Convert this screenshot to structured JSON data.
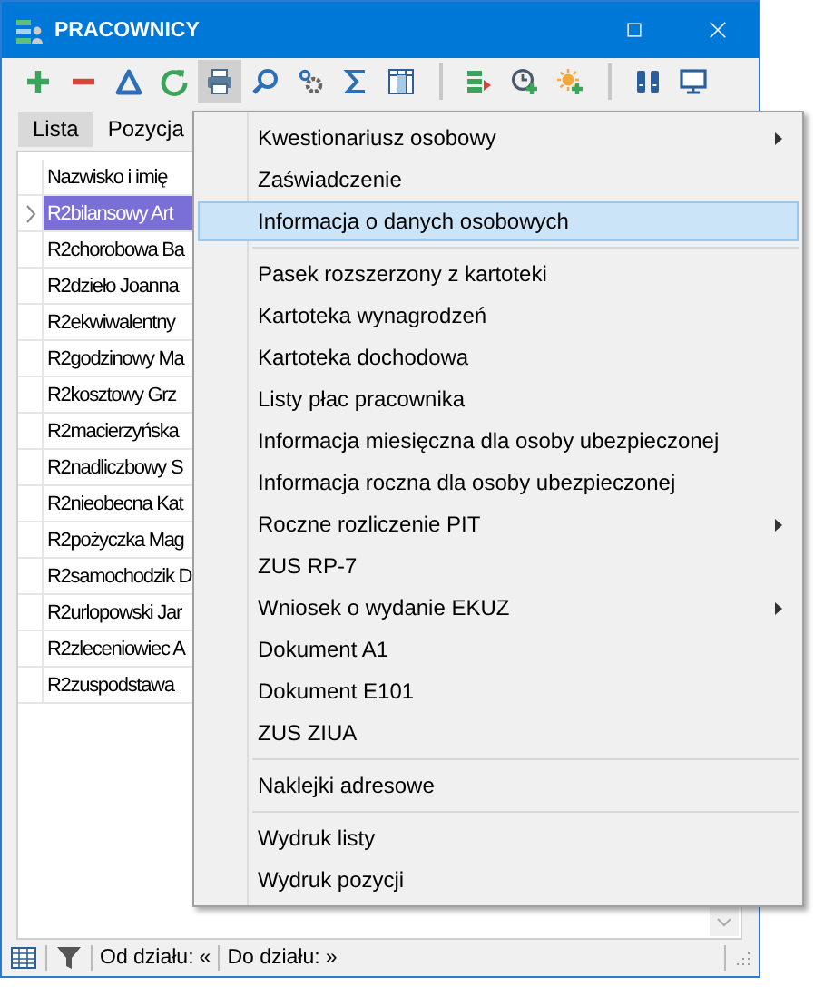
{
  "window": {
    "title": "PRACOWNICY"
  },
  "toolbar": {
    "groups": [
      [
        {
          "pressed": false
        },
        {
          "pressed": false
        },
        {
          "pressed": false
        },
        {
          "pressed": false
        },
        {
          "pressed": true
        },
        {
          "pressed": false
        },
        {
          "pressed": false
        },
        {
          "pressed": false
        },
        {
          "pressed": false
        }
      ],
      [
        {
          "pressed": false
        },
        {
          "pressed": false
        },
        {
          "pressed": false
        }
      ],
      [
        {
          "pressed": false
        },
        {
          "pressed": false
        }
      ]
    ]
  },
  "tabs": [
    {
      "label": "Lista",
      "selected": true
    },
    {
      "label": "Pozycja",
      "selected": false
    }
  ],
  "table": {
    "columns": [
      "Nazwisko i imię"
    ],
    "rows": [
      {
        "name": "R2bilansowy Art",
        "selected": true
      },
      {
        "name": "R2chorobowa Ba",
        "selected": false
      },
      {
        "name": "R2dzieło Joanna",
        "selected": false
      },
      {
        "name": "R2ekwiwalentny",
        "selected": false
      },
      {
        "name": "R2godzinowy Ma",
        "selected": false
      },
      {
        "name": "R2kosztowy Grz",
        "selected": false
      },
      {
        "name": "R2macierzyńska",
        "selected": false
      },
      {
        "name": "R2nadliczbowy S",
        "selected": false
      },
      {
        "name": "R2nieobecna Kat",
        "selected": false
      },
      {
        "name": "R2pożyczka Mag",
        "selected": false
      },
      {
        "name": "R2samochodzik D",
        "selected": false
      },
      {
        "name": "R2urlopowski Jar",
        "selected": false
      },
      {
        "name": "R2zleceniowiec A",
        "selected": false
      },
      {
        "name": "R2zuspodstawa",
        "selected": false
      }
    ]
  },
  "status_bar": {
    "from_label": "Od działu:",
    "from_value": "«",
    "to_label": "Do działu:",
    "to_value": "»"
  },
  "menu": {
    "items": [
      {
        "kind": "item",
        "label": "Kwestionariusz osobowy",
        "submenu": true,
        "selected": false
      },
      {
        "kind": "item",
        "label": "Zaświadczenie",
        "submenu": false,
        "selected": false
      },
      {
        "kind": "item",
        "label": "Informacja o danych osobowych",
        "submenu": false,
        "selected": true
      },
      {
        "kind": "separator"
      },
      {
        "kind": "item",
        "label": "Pasek rozszerzony z kartoteki",
        "submenu": false,
        "selected": false
      },
      {
        "kind": "item",
        "label": "Kartoteka wynagrodzeń",
        "submenu": false,
        "selected": false
      },
      {
        "kind": "item",
        "label": "Kartoteka dochodowa",
        "submenu": false,
        "selected": false
      },
      {
        "kind": "item",
        "label": "Listy płac pracownika",
        "submenu": false,
        "selected": false
      },
      {
        "kind": "item",
        "label": "Informacja miesięczna dla osoby ubezpieczonej",
        "submenu": false,
        "selected": false
      },
      {
        "kind": "item",
        "label": "Informacja roczna dla osoby ubezpieczonej",
        "submenu": false,
        "selected": false
      },
      {
        "kind": "item",
        "label": "Roczne rozliczenie PIT",
        "submenu": true,
        "selected": false
      },
      {
        "kind": "item",
        "label": "ZUS RP-7",
        "submenu": false,
        "selected": false
      },
      {
        "kind": "item",
        "label": "Wniosek o wydanie EKUZ",
        "submenu": true,
        "selected": false
      },
      {
        "kind": "item",
        "label": "Dokument A1",
        "submenu": false,
        "selected": false
      },
      {
        "kind": "item",
        "label": "Dokument E101",
        "submenu": false,
        "selected": false
      },
      {
        "kind": "item",
        "label": "ZUS ZIUA",
        "submenu": false,
        "selected": false
      },
      {
        "kind": "separator"
      },
      {
        "kind": "item",
        "label": "Naklejki adresowe",
        "submenu": false,
        "selected": false
      },
      {
        "kind": "separator"
      },
      {
        "kind": "item",
        "label": "Wydruk listy",
        "submenu": false,
        "selected": false
      },
      {
        "kind": "item",
        "label": "Wydruk pozycji",
        "submenu": false,
        "selected": false
      }
    ]
  }
}
